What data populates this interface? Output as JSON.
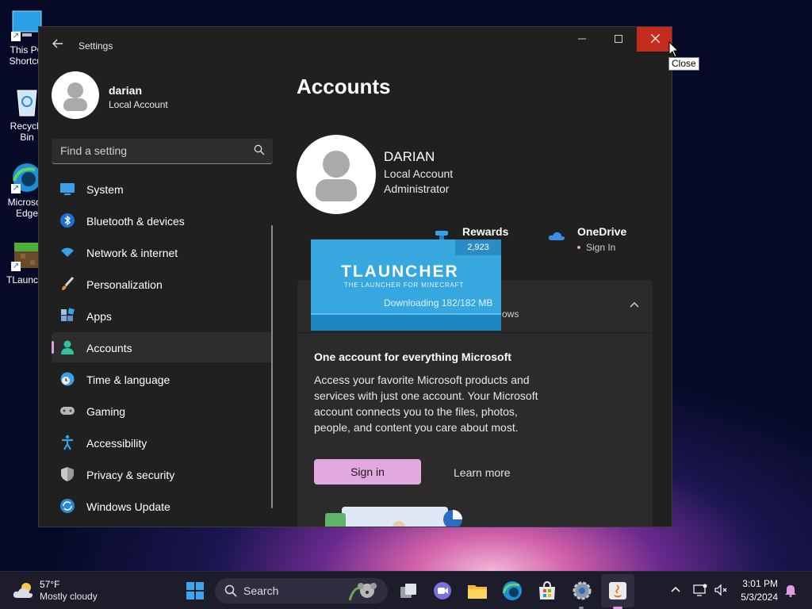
{
  "desktop": {
    "icons": [
      {
        "label_line1": "This PC",
        "label_line2": "Shortcut"
      },
      {
        "label_line1": "Recycle Bin",
        "label_line2": ""
      },
      {
        "label_line1": "Microsoft",
        "label_line2": "Edge"
      },
      {
        "label_line1": "TLauncher",
        "label_line2": ""
      }
    ]
  },
  "window": {
    "title": "Settings",
    "close_tooltip": "Close"
  },
  "sidebar": {
    "profile_name": "darian",
    "profile_type": "Local Account",
    "search_placeholder": "Find a setting",
    "items": [
      {
        "label": "System",
        "icon": "monitor-icon"
      },
      {
        "label": "Bluetooth & devices",
        "icon": "bluetooth-icon"
      },
      {
        "label": "Network & internet",
        "icon": "wifi-icon"
      },
      {
        "label": "Personalization",
        "icon": "paintbrush-icon"
      },
      {
        "label": "Apps",
        "icon": "apps-icon"
      },
      {
        "label": "Accounts",
        "icon": "person-icon",
        "active": true
      },
      {
        "label": "Time & language",
        "icon": "globe-clock-icon"
      },
      {
        "label": "Gaming",
        "icon": "gamepad-icon"
      },
      {
        "label": "Accessibility",
        "icon": "accessibility-icon"
      },
      {
        "label": "Privacy & security",
        "icon": "shield-icon"
      },
      {
        "label": "Windows Update",
        "icon": "update-icon"
      }
    ]
  },
  "main": {
    "page_title": "Accounts",
    "user": {
      "name": "DARIAN",
      "account_type": "Local Account",
      "role": "Administrator"
    },
    "rewards": {
      "title": "Rewards"
    },
    "onedrive": {
      "title": "OneDrive",
      "status": "Sign In"
    },
    "ms_card": {
      "subtitle_fragment": "ows",
      "heading": "One account for everything Microsoft",
      "body": "Access your favorite Microsoft products and services with just one account. Your Microsoft account connects you to the files, photos, people, and content you care about most.",
      "signin_label": "Sign in",
      "learn_more_label": "Learn more"
    }
  },
  "tlauncher": {
    "logo": "TLAUNCHER",
    "tagline": "THE LAUNCHER FOR MINECRAFT",
    "count": "2,923",
    "status": "Downloading 182/182 MB",
    "progress": 1.0
  },
  "taskbar": {
    "weather_temp": "57°F",
    "weather_desc": "Mostly cloudy",
    "search_label": "Search",
    "time": "3:01 PM",
    "date": "5/3/2024"
  },
  "colors": {
    "accent": "#e2a9e0",
    "close_red": "#c42b1c",
    "tlauncher_blue": "#37a7e0"
  }
}
